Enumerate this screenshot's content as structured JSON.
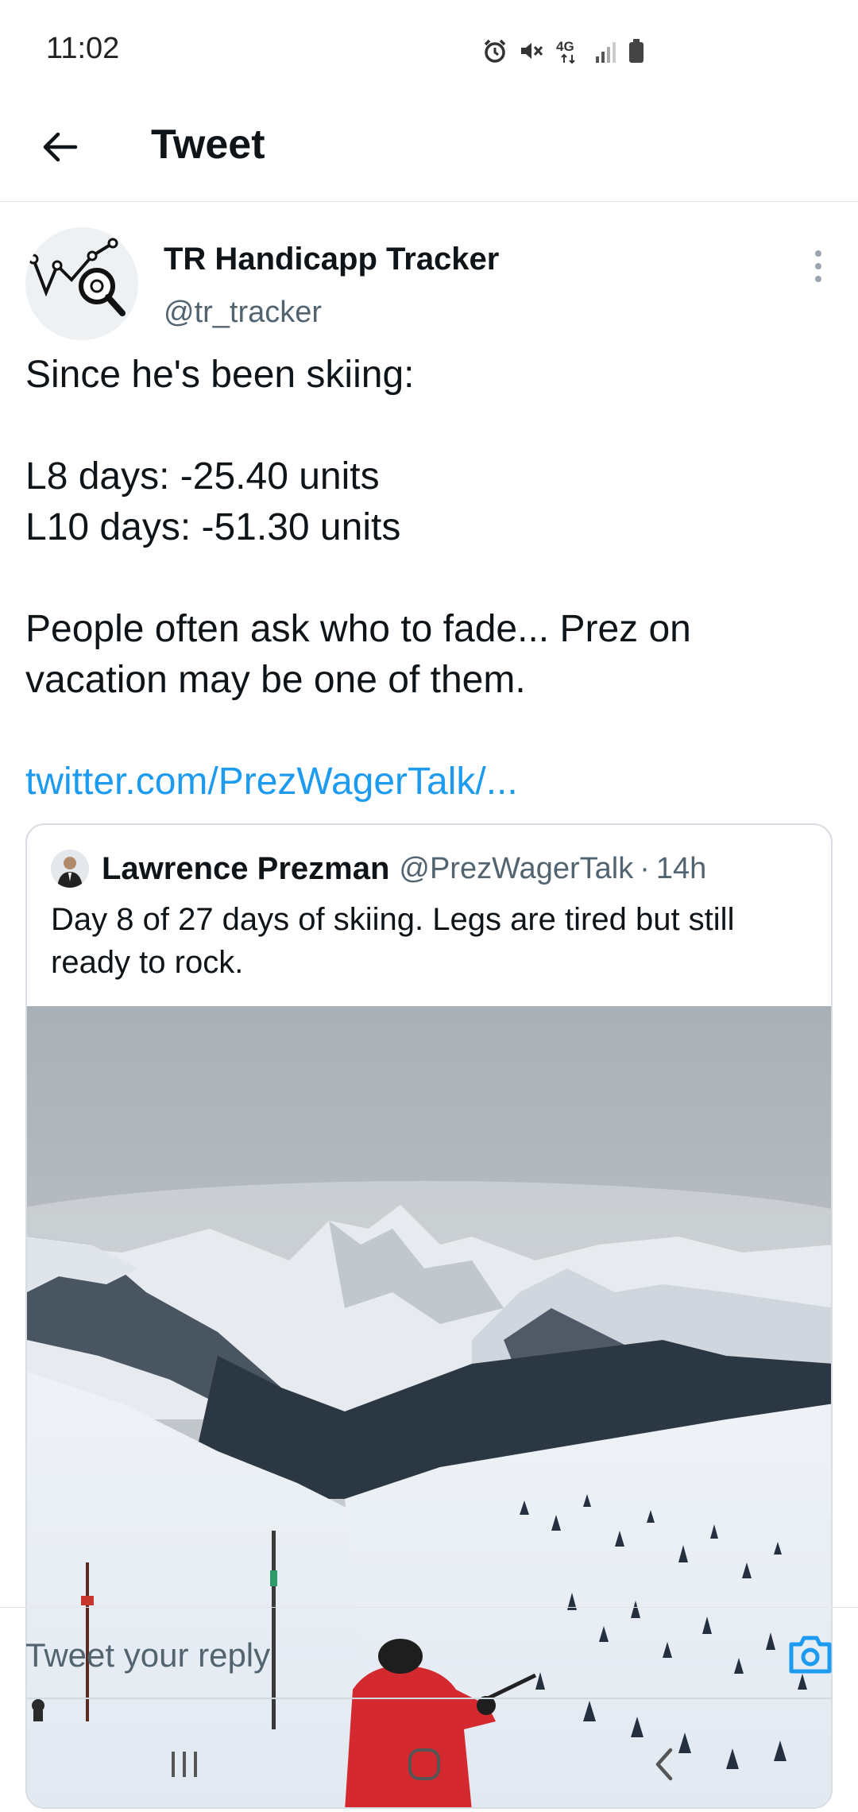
{
  "status_bar": {
    "time": "11:02",
    "network": "4G",
    "icons": [
      "alarm-icon",
      "mute-icon",
      "network-4g-icon",
      "signal-icon",
      "battery-icon"
    ]
  },
  "header": {
    "title": "Tweet",
    "back_icon": "arrow-left-icon"
  },
  "tweet": {
    "author_name": "TR Handicapp Tracker",
    "author_handle": "@tr_tracker",
    "text_lines": [
      "Since he's been skiing:",
      "",
      "L8 days: -25.40 units",
      "L10 days: -51.30 units",
      "",
      "People often ask who to fade... Prez on",
      "vacation may be one of them."
    ],
    "link": "twitter.com/PrezWagerTalk/..."
  },
  "quote": {
    "author_name": "Lawrence Prezman",
    "author_handle": "@PrezWagerTalk",
    "separator": "·",
    "time": "14h",
    "text": "Day 8 of 27 days of skiing. Legs are tired but still ready to rock."
  },
  "reply": {
    "placeholder": "Tweet your reply",
    "camera_icon": "camera-icon"
  },
  "nav": {
    "recents_icon": "recents-icon",
    "home_icon": "home-icon",
    "back_icon": "back-icon"
  },
  "colors": {
    "link": "#1d9bf0",
    "secondary_text": "#536471",
    "primary_text": "#0f1419",
    "jacket": "#d42a2f"
  }
}
